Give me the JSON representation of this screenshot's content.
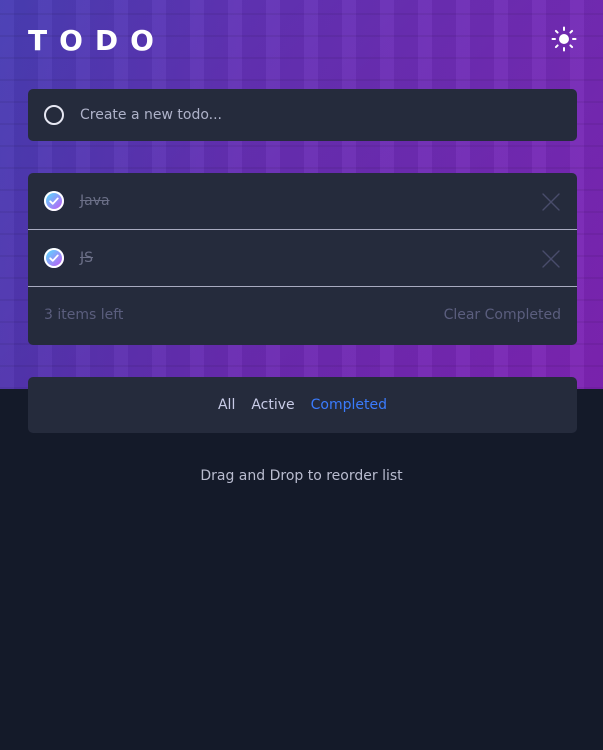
{
  "header": {
    "title": "TODO",
    "theme_icon": "sun-icon"
  },
  "new_todo": {
    "placeholder": "Create a new todo..."
  },
  "todos": [
    {
      "text": "Java",
      "completed": true
    },
    {
      "text": "JS",
      "completed": true
    }
  ],
  "footer": {
    "items_left": "3 items left",
    "clear_label": "Clear Completed"
  },
  "filters": {
    "all": "All",
    "active": "Active",
    "completed": "Completed",
    "selected": "Completed"
  },
  "hint": "Drag and Drop to reorder list",
  "colors": {
    "accent": "#3a7bfd",
    "check_gradient_start": "#57ddff",
    "check_gradient_end": "#c058f3",
    "card_bg": "#252b3c",
    "page_bg": "#141a29"
  }
}
